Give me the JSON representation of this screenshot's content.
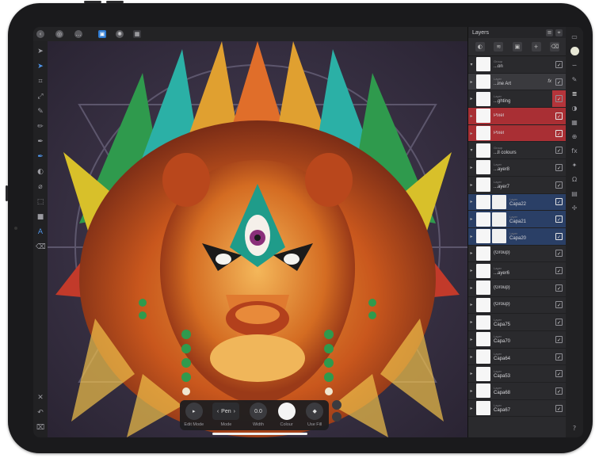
{
  "app": {
    "top_toolbar": [
      "back-icon",
      "document-icon",
      "more-icon",
      "persona-pixel-icon",
      "persona-export-icon",
      "grid-icon"
    ]
  },
  "left_tools": [
    "move-icon",
    "select-icon",
    "crop-icon",
    "transform-icon",
    "brush-icon",
    "pencil-icon",
    "pen-icon",
    "fill-icon",
    "vector-pen-icon",
    "eyedropper-icon",
    "shape-icon",
    "rectangle-icon",
    "text-icon",
    "eraser-icon"
  ],
  "left_tools_bottom": [
    "close-icon",
    "undo-icon",
    "trash-icon"
  ],
  "context_toolbar": {
    "edit_mode": "Edit Mode",
    "mode_value": "Pen",
    "mode_label": "Mode",
    "width_value": "0.0",
    "width_label": "Width",
    "colour_label": "Colour",
    "usefill_label": "Use Fill"
  },
  "panel": {
    "title": "Layers",
    "tools": [
      "blend-icon",
      "layer-fx-icon",
      "mask-icon",
      "add-layer-icon",
      "delete-icon"
    ]
  },
  "layers": [
    {
      "name": "...on",
      "sub": "Group",
      "style": "group",
      "checked": true
    },
    {
      "name": "...ine Art",
      "sub": "Layer",
      "style": "sel",
      "fx": "fx",
      "checked": true
    },
    {
      "name": "...ghting",
      "sub": "Layer",
      "style": "plain",
      "checked": true,
      "bar": "red"
    },
    {
      "name": "Pixel",
      "sub": "",
      "style": "red",
      "checked": true
    },
    {
      "name": "Pixel",
      "sub": "",
      "style": "red",
      "checked": true
    },
    {
      "name": "...ll colours",
      "sub": "Group",
      "style": "plain",
      "checked": true
    },
    {
      "name": "...ayer8",
      "sub": "Layer",
      "style": "plain",
      "checked": true
    },
    {
      "name": "...ayer7",
      "sub": "Layer",
      "style": "plain",
      "checked": true
    },
    {
      "name": "Capa22",
      "sub": "Layer",
      "style": "blue",
      "checked": true
    },
    {
      "name": "Capa21",
      "sub": "Layer",
      "style": "blue",
      "checked": true
    },
    {
      "name": "Capa20",
      "sub": "Layer",
      "style": "blue",
      "checked": true
    },
    {
      "name": "(Group)",
      "sub": "",
      "style": "plain",
      "checked": true
    },
    {
      "name": "...ayer6",
      "sub": "Layer",
      "style": "plain",
      "checked": true
    },
    {
      "name": "(Group)",
      "sub": "",
      "style": "plain",
      "checked": true
    },
    {
      "name": "(Group)",
      "sub": "",
      "style": "plain",
      "checked": true
    },
    {
      "name": "Capa75",
      "sub": "Layer",
      "style": "plain",
      "checked": true
    },
    {
      "name": "Capa70",
      "sub": "Layer",
      "style": "plain",
      "checked": true
    },
    {
      "name": "Capa64",
      "sub": "Layer",
      "style": "plain",
      "checked": true
    },
    {
      "name": "Capa53",
      "sub": "Layer",
      "style": "plain",
      "checked": true
    },
    {
      "name": "Capa68",
      "sub": "Layer",
      "style": "plain",
      "checked": true
    },
    {
      "name": "Capa67",
      "sub": "Layer",
      "style": "plain",
      "checked": true
    }
  ],
  "studio": [
    "color-icon",
    "stroke-icon",
    "brushes-icon",
    "layers-icon",
    "adjustments-icon",
    "swatches-icon",
    "transform-icon",
    "effects-icon",
    "styles-icon",
    "text-styles-icon",
    "glyph-icon",
    "stock-icon",
    "navigator-icon",
    "help-icon"
  ],
  "studio_labels": {
    "glyph": "Ω",
    "help": "?"
  }
}
